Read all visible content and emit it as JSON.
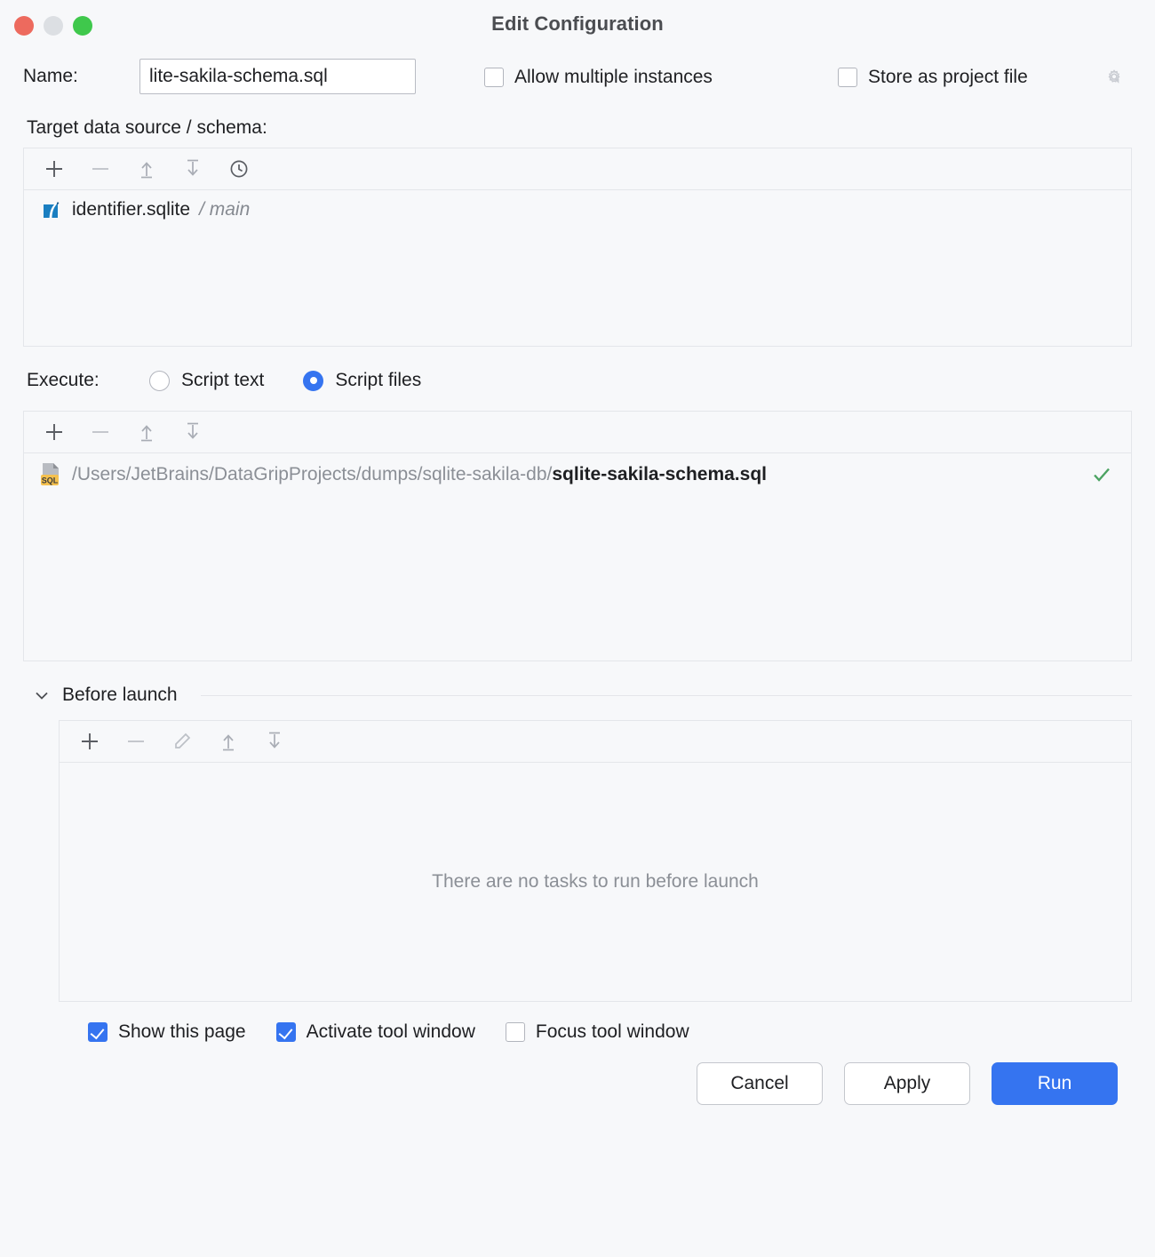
{
  "window": {
    "title": "Edit Configuration",
    "traffic_lights": [
      "close-button",
      "minimize-button",
      "maximize-button"
    ],
    "colors": {
      "close": "#ed6a5e",
      "minimize": "#dcdfe3",
      "maximize": "#3fc84c",
      "accent": "#3574f0",
      "background": "#f7f8fa",
      "border": "#e4e6ea",
      "success": "#4ca362",
      "muted_text": "#8b8f96"
    }
  },
  "name_field": {
    "label": "Name:",
    "value": "lite-sakila-schema.sql",
    "placeholder": "Configuration name"
  },
  "header_options": {
    "allow_multiple_instances": {
      "label": "Allow multiple instances",
      "checked": false
    },
    "store_as_project_file": {
      "label": "Store as project file",
      "checked": false,
      "icon": "gear-icon"
    }
  },
  "target_section": {
    "label": "Target data source / schema:",
    "toolbar": [
      {
        "name": "add-data-source-button",
        "icon": "plus-icon",
        "enabled": true
      },
      {
        "name": "remove-data-source-button",
        "icon": "minus-icon",
        "enabled": false
      },
      {
        "name": "move-up-button",
        "icon": "arrow-up-to-bar-icon",
        "enabled": false
      },
      {
        "name": "move-down-button",
        "icon": "arrow-down-to-bar-icon",
        "enabled": false
      },
      {
        "name": "history-button",
        "icon": "clock-icon",
        "enabled": true
      }
    ],
    "items": [
      {
        "icon": "sqlite-icon",
        "name": "identifier.sqlite",
        "separator": " / ",
        "schema": "main"
      }
    ]
  },
  "execute_section": {
    "label": "Execute:",
    "options": [
      {
        "label": "Script text",
        "selected": false
      },
      {
        "label": "Script files",
        "selected": true
      }
    ]
  },
  "script_files_section": {
    "toolbar": [
      {
        "name": "add-script-file-button",
        "icon": "plus-icon",
        "enabled": true
      },
      {
        "name": "remove-script-file-button",
        "icon": "minus-icon",
        "enabled": false
      },
      {
        "name": "move-up-button",
        "icon": "arrow-up-to-bar-icon",
        "enabled": false
      },
      {
        "name": "move-down-button",
        "icon": "arrow-down-to-bar-icon",
        "enabled": false
      }
    ],
    "files": [
      {
        "icon": "sql-file-icon",
        "directory": "/Users/JetBrains/DataGripProjects/dumps/sqlite-sakila-db/",
        "filename": "sqlite-sakila-schema.sql",
        "status_icon": "green-check-icon"
      }
    ]
  },
  "before_launch": {
    "title": "Before launch",
    "expanded": true,
    "collapse_icon": "chevron-down-icon",
    "toolbar": [
      {
        "name": "add-task-button",
        "icon": "plus-icon",
        "enabled": true
      },
      {
        "name": "remove-task-button",
        "icon": "minus-icon",
        "enabled": false
      },
      {
        "name": "edit-task-button",
        "icon": "pencil-icon",
        "enabled": false
      },
      {
        "name": "move-up-button",
        "icon": "arrow-up-to-bar-icon",
        "enabled": false
      },
      {
        "name": "move-down-button",
        "icon": "arrow-down-to-bar-icon",
        "enabled": false
      }
    ],
    "empty_message": "There are no tasks to run before launch"
  },
  "bottom_options": [
    {
      "label": "Show this page",
      "checked": true
    },
    {
      "label": "Activate tool window",
      "checked": true
    },
    {
      "label": "Focus tool window",
      "checked": false
    }
  ],
  "buttons": {
    "cancel": "Cancel",
    "apply": "Apply",
    "run": "Run"
  }
}
